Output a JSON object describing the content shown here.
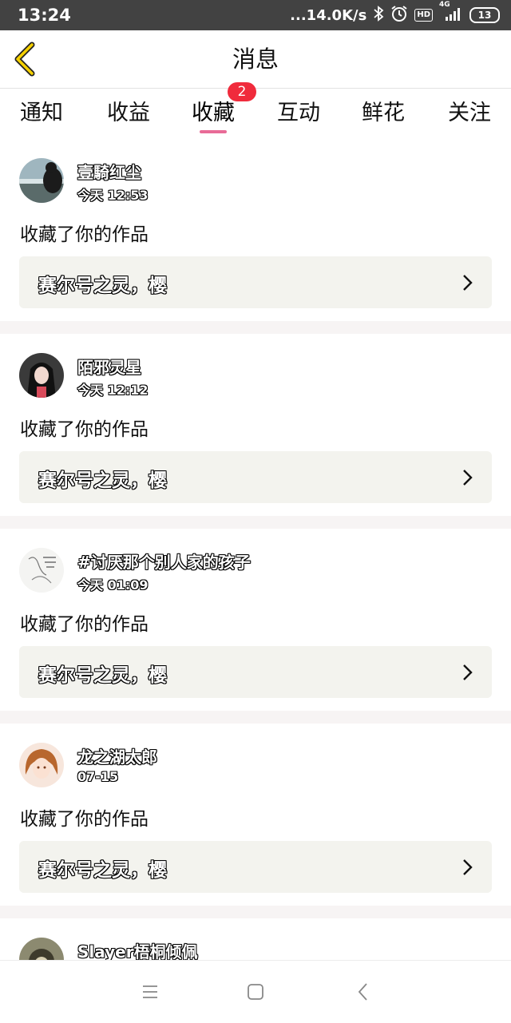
{
  "status": {
    "time": "13:24",
    "net_speed": "...14.0K/s",
    "hd": "HD",
    "signal_label": "4G",
    "battery": "13",
    "icons": [
      "bluetooth-icon",
      "alarm-icon",
      "hd-icon",
      "signal-icon",
      "battery-icon"
    ]
  },
  "nav": {
    "title": "消息",
    "back_icon": "chevron-left-icon",
    "accent": "#f5d000"
  },
  "tabs": [
    {
      "label": "通知"
    },
    {
      "label": "收益"
    },
    {
      "label": "收藏",
      "active": true,
      "badge": "2"
    },
    {
      "label": "互动"
    },
    {
      "label": "鲜花"
    },
    {
      "label": "关注"
    }
  ],
  "colors": {
    "tab_underline": "#e86b97",
    "badge": "#f02b3c",
    "card_bg": "#f3f3ee",
    "separator": "#f7f4f4"
  },
  "messages": [
    {
      "name": "壹騎红尘",
      "time": "今天 12:53",
      "action": "收藏了你的作品",
      "work": "赛尔号之灵，樱"
    },
    {
      "name": "陌邪灵星",
      "time": "今天 12:12",
      "action": "收藏了你的作品",
      "work": "赛尔号之灵，樱"
    },
    {
      "name": "#讨厌那个别人家的孩子",
      "time": "今天 01:09",
      "action": "收藏了你的作品",
      "work": "赛尔号之灵，樱"
    },
    {
      "name": "龙之湖太郎",
      "time": "07-15",
      "action": "收藏了你的作品",
      "work": "赛尔号之灵，樱"
    },
    {
      "name": "Slayer梧桐倾佩"
    }
  ],
  "bottom_nav": [
    "menu-icon",
    "home-square-icon",
    "back-triangle-icon"
  ]
}
